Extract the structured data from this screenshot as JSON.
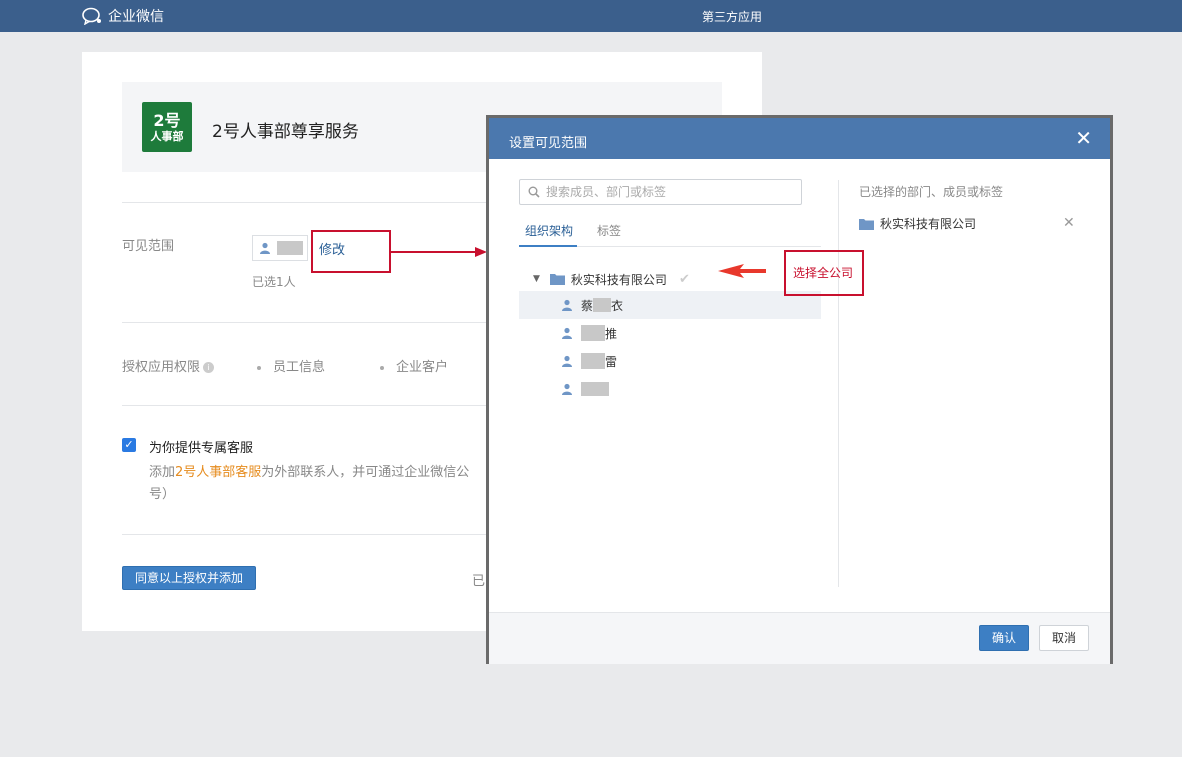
{
  "topbar": {
    "logo_text": "企业微信",
    "center_title": "第三方应用"
  },
  "app": {
    "icon_number": "2号",
    "icon_text": "人事部",
    "name": "2号人事部尊享服务"
  },
  "visibility": {
    "label": "可见范围",
    "modify_link": "修改",
    "selected_count": "已选1人"
  },
  "permissions": {
    "label": "授权应用权限",
    "items": [
      "员工信息",
      "企业客户"
    ]
  },
  "customer_service": {
    "checked": true,
    "title": "为你提供专属客服",
    "desc_prefix": "添加",
    "desc_highlight": "2号人事部客服",
    "desc_suffix": "为外部联系人，并可通过企业微信公",
    "desc_wrap": "号）"
  },
  "footer": {
    "agree_button": "同意以上授权并添加",
    "tail_text": "已"
  },
  "dialog": {
    "title": "设置可见范围",
    "close_icon": "close-icon",
    "search_placeholder": "搜索成员、部门或标签",
    "tabs": [
      "组织架构",
      "标签"
    ],
    "active_tab": "组织架构",
    "tree_root": "秋实科技有限公司",
    "members": [
      {
        "prefix": "蔡",
        "suffix": "衣"
      },
      {
        "prefix": "",
        "suffix": "推"
      },
      {
        "prefix": "",
        "suffix": "雷"
      },
      {
        "prefix": "",
        "suffix": ""
      }
    ],
    "right_title": "已选择的部门、成员或标签",
    "right_selected": "秋实科技有限公司",
    "confirm_button": "确认",
    "cancel_button": "取消"
  },
  "annotation": {
    "note": "选择全公司"
  },
  "colors": {
    "topbar": "#3b5f8c",
    "dialog_header": "#4b78ae",
    "primary_button": "#3d7fc4",
    "annotation_red": "#c8102e",
    "highlight_orange": "#e68c1f"
  }
}
